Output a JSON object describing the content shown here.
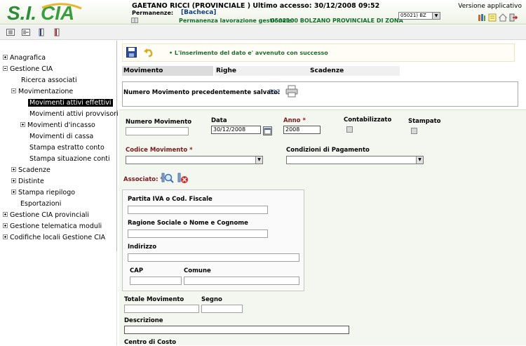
{
  "header": {
    "logo_text": "S.I.CIA",
    "user_line": "GAETANO RICCI (PROVINCIALE ) Ultimo accesso: 30/12/2008 09:52",
    "permanenze_label": "Permanenze:",
    "permanenze_value": "[Bacheca]",
    "perm_lav_label": "Permanenza lavorazione gestionale:",
    "perm_lav_value": "0502100 BOLZANO PROVINCIALE DI ZONA",
    "province_select": "05021) BZ",
    "version_label": "Versione applicativo"
  },
  "sidebar": {
    "items": [
      {
        "label": "Anagrafica",
        "expander": "plus"
      },
      {
        "label": "Gestione CIA",
        "expander": "minus"
      },
      {
        "label": "Ricerca associati",
        "expander": ""
      },
      {
        "label": "Movimentazione",
        "expander": "minus"
      },
      {
        "label": "Movimenti attivi effettivi",
        "expander": "",
        "selected": true
      },
      {
        "label": "Movimenti attivi provvisori",
        "expander": ""
      },
      {
        "label": "Movimenti d'incasso",
        "expander": "plus"
      },
      {
        "label": "Movimenti di cassa",
        "expander": ""
      },
      {
        "label": "Stampa estratto conto",
        "expander": ""
      },
      {
        "label": "Stampa situazione conti",
        "expander": ""
      },
      {
        "label": "Scadenze",
        "expander": "plus"
      },
      {
        "label": "Distinte",
        "expander": "plus"
      },
      {
        "label": "Stampa riepilogo",
        "expander": "plus"
      },
      {
        "label": "Esportazioni",
        "expander": ""
      },
      {
        "label": "Gestione CIA provinciali",
        "expander": "plus"
      },
      {
        "label": "Gestione telematica moduli",
        "expander": "plus"
      },
      {
        "label": "Codifiche locali Gestione CIA",
        "expander": "plus"
      }
    ]
  },
  "main": {
    "success_message": "• L'inserimento del dato e' avvenuto con successo",
    "tabs": [
      "Movimento",
      "Righe",
      "Scadenze"
    ],
    "saved_label": "Numero Movimento precedentemente salvato:",
    "saved_number": "537"
  },
  "form": {
    "numero_movimento_label": "Numero Movimento",
    "data_label": "Data",
    "data_value": "30/12/2008",
    "anno_label": "Anno *",
    "anno_value": "2008",
    "contabilizzato_label": "Contabilizzato",
    "stampato_label": "Stampato",
    "codice_movimento_label": "Codice Movimento *",
    "condizioni_label": "Condizioni di Pagamento",
    "associato_label": "Associato: *",
    "partita_iva_label": "Partita IVA o Cod. Fiscale",
    "ragione_sociale_label": "Ragione Sociale o Nome e Cognome",
    "indirizzo_label": "Indirizzo",
    "cap_label": "CAP",
    "comune_label": "Comune",
    "totale_label": "Totale Movimento",
    "segno_label": "Segno",
    "descrizione_label": "Descrizione",
    "centro_costo_label": "Centro di Costo"
  }
}
